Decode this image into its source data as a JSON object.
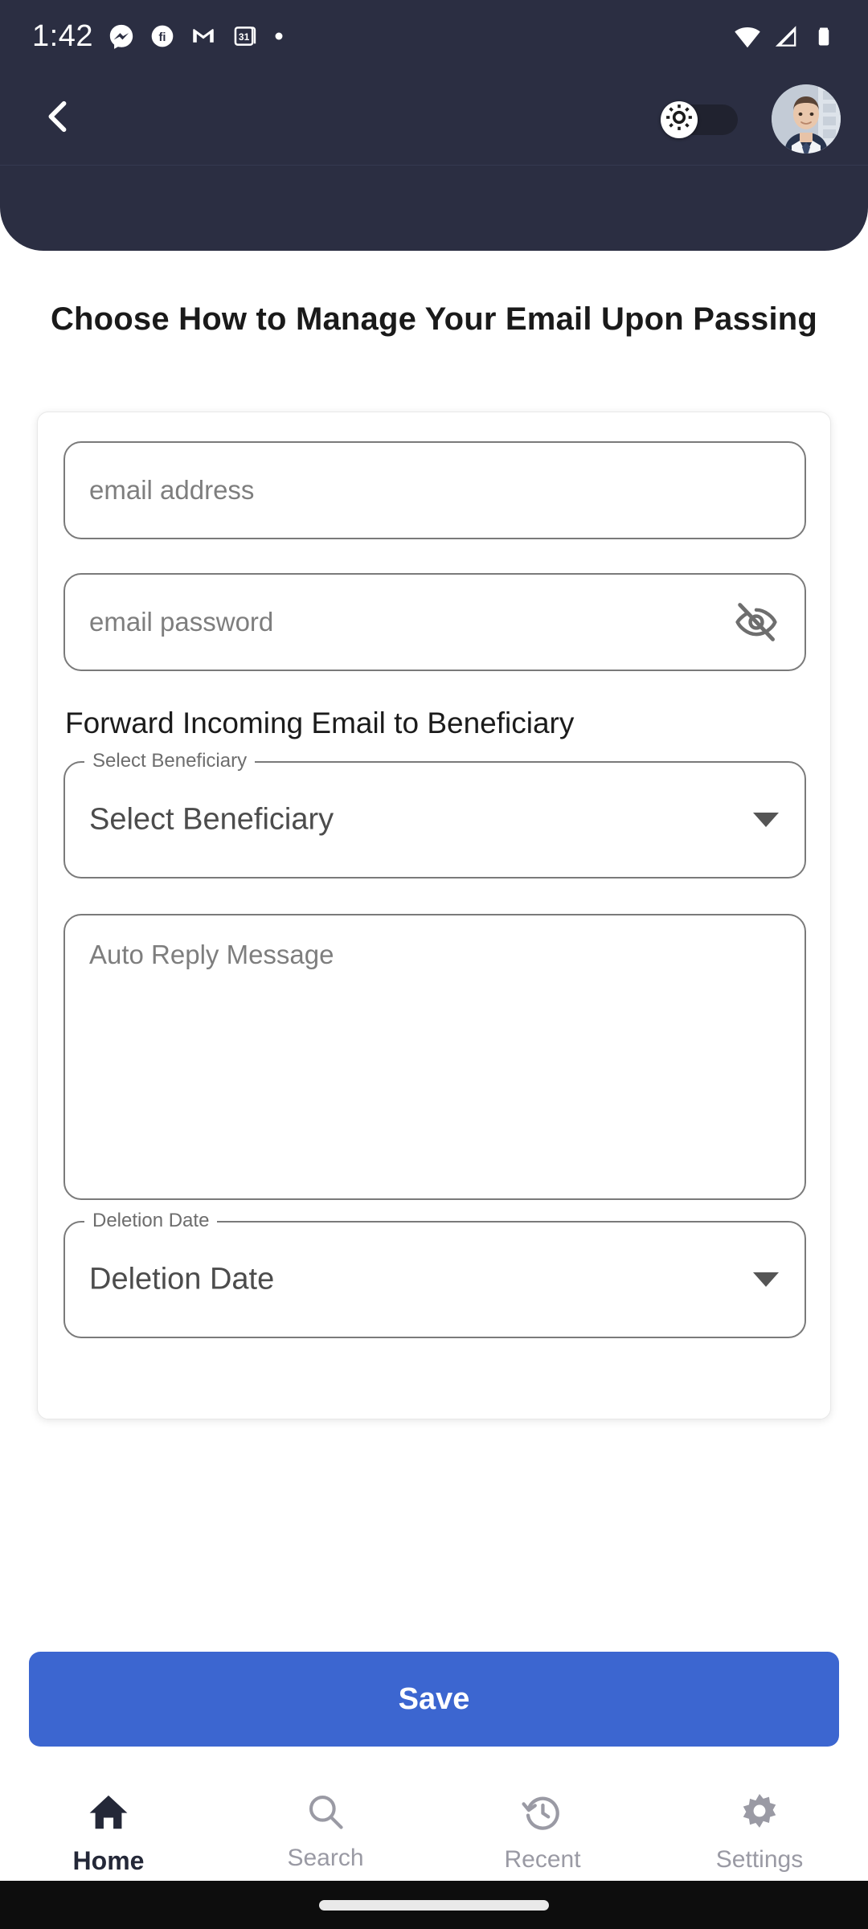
{
  "status_bar": {
    "time": "1:42",
    "left_icons": [
      "messenger-icon",
      "app-circle-icon",
      "gmail-icon",
      "calendar-31-icon",
      "dot-icon"
    ],
    "right_icons": [
      "wifi-icon",
      "cellular-signal-icon",
      "battery-icon"
    ],
    "background_color": "#2B2E42"
  },
  "app_bar": {
    "back_icon": "chevron-left-icon",
    "theme_toggle": {
      "icon": "brightness-sun-icon",
      "state": "off",
      "track_color": "#20222F"
    },
    "avatar_alt": "user-profile-photo",
    "background_color": "#2B2E42"
  },
  "page": {
    "title": "Choose How to Manage Your Email Upon Passing"
  },
  "form": {
    "email": {
      "placeholder": "email address",
      "value": ""
    },
    "password": {
      "placeholder": "email password",
      "value": "",
      "toggle_icon": "eye-off-icon"
    },
    "section_heading": "Forward Incoming Email to Beneficiary",
    "beneficiary_select": {
      "label": "Select Beneficiary",
      "value": "Select Beneficiary",
      "arrow_icon": "chevron-down-icon"
    },
    "auto_reply": {
      "placeholder": "Auto Reply Message",
      "value": ""
    },
    "deletion_date_select": {
      "label": "Deletion Date",
      "value": "Deletion Date",
      "arrow_icon": "chevron-down-icon"
    }
  },
  "actions": {
    "save_label": "Save",
    "save_color": "#3C66D0"
  },
  "bottom_nav": {
    "items": [
      {
        "label": "Home",
        "icon": "home-icon",
        "active": true
      },
      {
        "label": "Search",
        "icon": "search-icon",
        "active": false
      },
      {
        "label": "Recent",
        "icon": "history-icon",
        "active": false
      },
      {
        "label": "Settings",
        "icon": "gear-icon",
        "active": false
      }
    ],
    "active_color": "#242838",
    "inactive_color": "#9a9aa4"
  }
}
